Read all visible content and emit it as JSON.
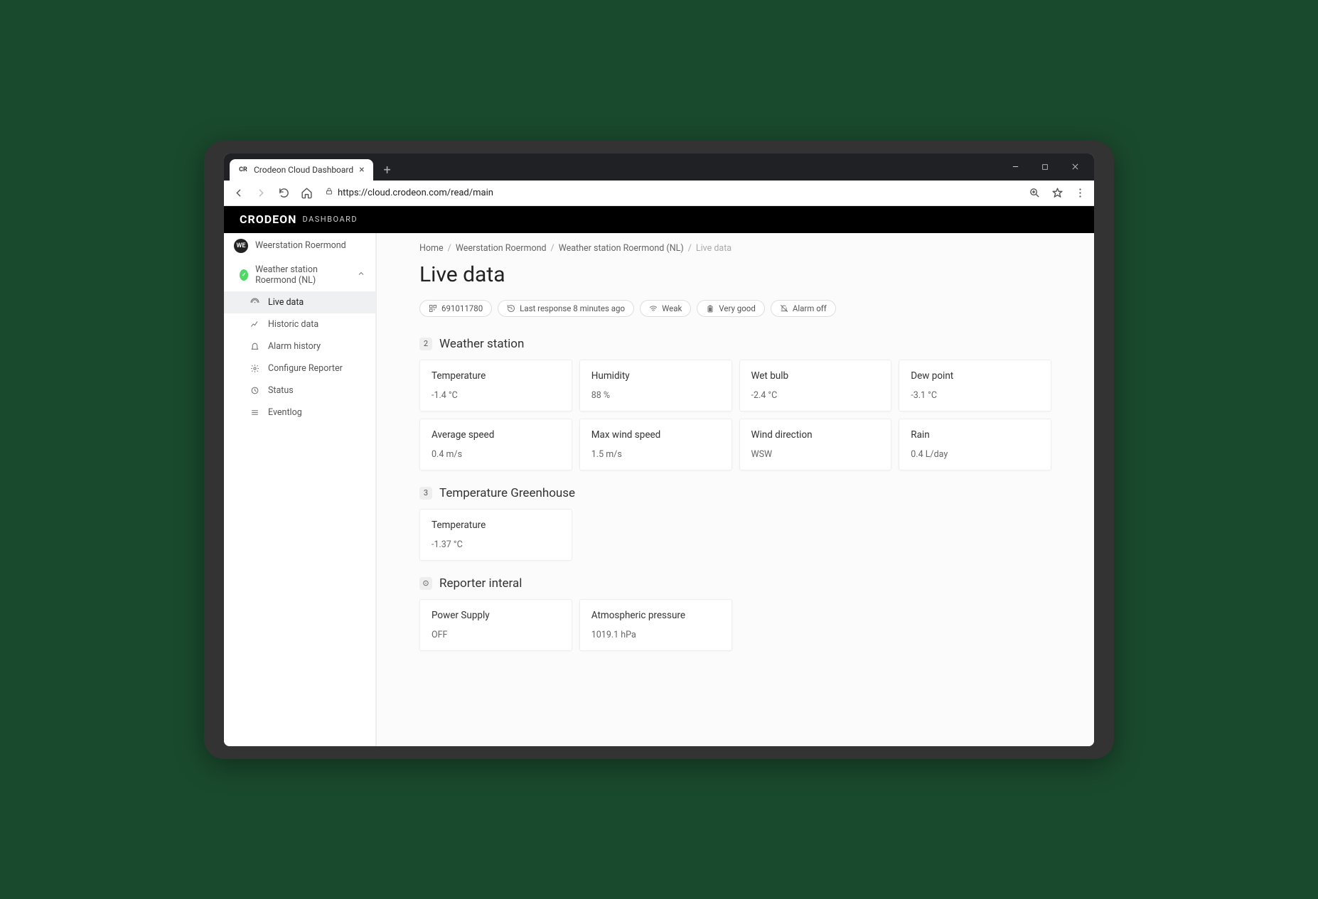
{
  "browser": {
    "tab_title": "Crodeon Cloud Dashboard",
    "tab_favicon": "CR",
    "url": "https://cloud.crodeon.com/read/main"
  },
  "header": {
    "brand": "CRODEON",
    "sub": "DASHBOARD"
  },
  "sidebar": {
    "project": {
      "avatar": "WE",
      "name": "Weerstation Roermond"
    },
    "station": {
      "name": "Weather station Roermond (NL)"
    },
    "items": [
      {
        "label": "Live data",
        "icon": "broadcast-icon",
        "active": true
      },
      {
        "label": "Historic data",
        "icon": "chart-icon",
        "active": false
      },
      {
        "label": "Alarm history",
        "icon": "bell-icon",
        "active": false
      },
      {
        "label": "Configure Reporter",
        "icon": "gear-icon",
        "active": false
      },
      {
        "label": "Status",
        "icon": "clock-icon",
        "active": false
      },
      {
        "label": "Eventlog",
        "icon": "list-icon",
        "active": false
      }
    ]
  },
  "breadcrumb": {
    "items": [
      "Home",
      "Weerstation Roermond",
      "Weather station Roermond (NL)"
    ],
    "current": "Live data"
  },
  "page": {
    "title": "Live data"
  },
  "chips": [
    {
      "icon": "qr-icon",
      "label": "691011780"
    },
    {
      "icon": "history-icon",
      "label": "Last response 8 minutes ago"
    },
    {
      "icon": "wifi-icon",
      "label": "Weak"
    },
    {
      "icon": "battery-icon",
      "label": "Very good"
    },
    {
      "icon": "bell-off-icon",
      "label": "Alarm off"
    }
  ],
  "sections": [
    {
      "badge": "2",
      "title": "Weather station",
      "cards": [
        {
          "label": "Temperature",
          "value": "-1.4 °C"
        },
        {
          "label": "Humidity",
          "value": "88 %"
        },
        {
          "label": "Wet bulb",
          "value": "-2.4 °C"
        },
        {
          "label": "Dew point",
          "value": "-3.1 °C"
        },
        {
          "label": "Average speed",
          "value": "0.4 m/s"
        },
        {
          "label": "Max wind speed",
          "value": "1.5 m/s"
        },
        {
          "label": "Wind direction",
          "value": "WSW"
        },
        {
          "label": "Rain",
          "value": "0.4 L/day"
        }
      ]
    },
    {
      "badge": "3",
      "title": "Temperature Greenhouse",
      "cards": [
        {
          "label": "Temperature",
          "value": "-1.37 °C"
        }
      ]
    },
    {
      "badge": "⊙",
      "title": "Reporter interal",
      "cards": [
        {
          "label": "Power Supply",
          "value": "OFF"
        },
        {
          "label": "Atmospheric pressure",
          "value": "1019.1 hPa"
        }
      ]
    }
  ]
}
